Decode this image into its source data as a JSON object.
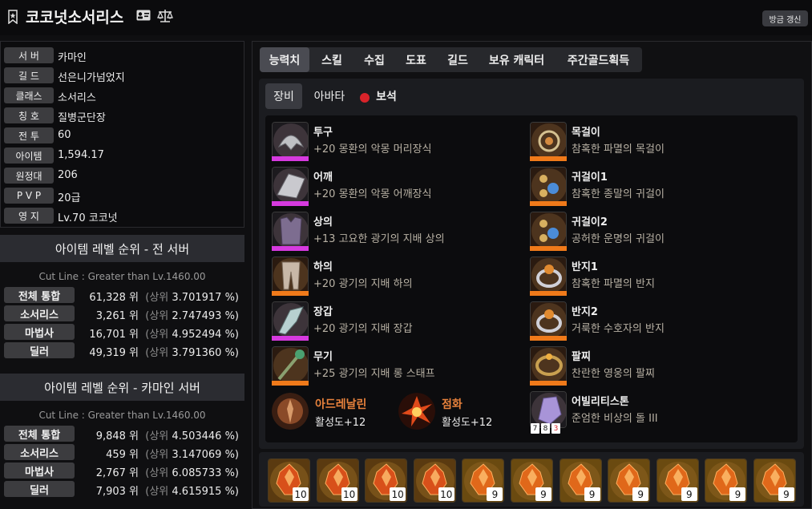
{
  "header": {
    "character_name": "코코넛소서리스",
    "refresh_label": "방금 갱신"
  },
  "profile": [
    {
      "label": "서  버",
      "value": "카마인"
    },
    {
      "label": "길  드",
      "value": "선은니가넘었지"
    },
    {
      "label": "클래스",
      "value": "소서리스"
    },
    {
      "label": "칭  호",
      "value": "질병군단장"
    },
    {
      "label": "전  투",
      "value": "60"
    },
    {
      "label": "아이템",
      "value": "1,594.17"
    },
    {
      "label": "원정대",
      "value": "206"
    },
    {
      "label": "P V P",
      "value": "20급"
    },
    {
      "label": "영  지",
      "value": "Lv.70 코코넛"
    }
  ],
  "ranking_all": {
    "title": "아이템 레벨 순위 - 전 서버",
    "cutline": "Cut Line : Greater than Lv.1460.00",
    "rows": [
      {
        "label": "전체 통합",
        "rank": "61,328 위",
        "top": "(상위",
        "pct": "3.701917 %)"
      },
      {
        "label": "소서리스",
        "rank": "3,261 위",
        "top": "(상위",
        "pct": "2.747493 %)"
      },
      {
        "label": "마법사",
        "rank": "16,701 위",
        "top": "(상위",
        "pct": "4.952494 %)"
      },
      {
        "label": "딜러",
        "rank": "49,319 위",
        "top": "(상위",
        "pct": "3.791360 %)"
      }
    ]
  },
  "ranking_server": {
    "title": "아이템 레벨 순위 - 카마인 서버",
    "cutline": "Cut Line : Greater than Lv.1460.00",
    "rows": [
      {
        "label": "전체 통합",
        "rank": "9,848 위",
        "top": "(상위",
        "pct": "4.503446 %)"
      },
      {
        "label": "소서리스",
        "rank": "459 위",
        "top": "(상위",
        "pct": "3.147069 %)"
      },
      {
        "label": "마법사",
        "rank": "2,767 위",
        "top": "(상위",
        "pct": "6.085733 %)"
      },
      {
        "label": "딜러",
        "rank": "7,903 위",
        "top": "(상위",
        "pct": "4.615915 %)"
      }
    ]
  },
  "main_tabs": [
    "능력치",
    "스킬",
    "수집",
    "도표",
    "길드",
    "보유 캐릭터",
    "주간골드획득"
  ],
  "sub_tabs": [
    "장비",
    "아바타",
    "보석"
  ],
  "armor": [
    {
      "type": "투구",
      "name": "+20 몽환의 악몽 머리장식",
      "bar_color": "#d63adf"
    },
    {
      "type": "어깨",
      "name": "+20 몽환의 악몽 어깨장식",
      "bar_color": "#d63adf"
    },
    {
      "type": "상의",
      "name": "+13 고요한 광기의 지배 상의",
      "bar_color": "#d63adf"
    },
    {
      "type": "하의",
      "name": "+20 광기의 지배 하의",
      "bar_color": "#f07a1a"
    },
    {
      "type": "장갑",
      "name": "+20 광기의 지배 장갑",
      "bar_color": "#d63adf"
    },
    {
      "type": "무기",
      "name": "+25 광기의 지배 롱 스태프",
      "bar_color": "#f07a1a"
    }
  ],
  "accessories": [
    {
      "type": "목걸이",
      "name": "참혹한 파멸의 목걸이",
      "bar_color": "#f07a1a"
    },
    {
      "type": "귀걸이1",
      "name": "참혹한 종말의 귀걸이",
      "bar_color": "#f07a1a"
    },
    {
      "type": "귀걸이2",
      "name": "공허한 운명의 귀걸이",
      "bar_color": "#f07a1a"
    },
    {
      "type": "반지1",
      "name": "참혹한 파멸의 반지",
      "bar_color": "#f07a1a"
    },
    {
      "type": "반지2",
      "name": "거룩한 수호자의 반지",
      "bar_color": "#f07a1a"
    },
    {
      "type": "팔찌",
      "name": "찬란한 영웅의 팔찌",
      "bar_color": "#f07a1a"
    }
  ],
  "engravings": [
    {
      "name": "아드레날린",
      "level": "활성도+12"
    },
    {
      "name": "점화",
      "level": "활성도+12"
    }
  ],
  "ability_stone": {
    "type": "어빌리티스톤",
    "name": "준엄한 비상의 돌 III",
    "levels": [
      "7",
      "8",
      "3"
    ]
  },
  "gems": [
    "10",
    "10",
    "10",
    "10",
    "9",
    "9",
    "9",
    "9",
    "9",
    "9",
    "9"
  ],
  "colors": {
    "relic": "#d63adf",
    "ancient": "#f07a1a",
    "engrave_name": "#e8823c",
    "gem_dot": "#d8232a"
  }
}
